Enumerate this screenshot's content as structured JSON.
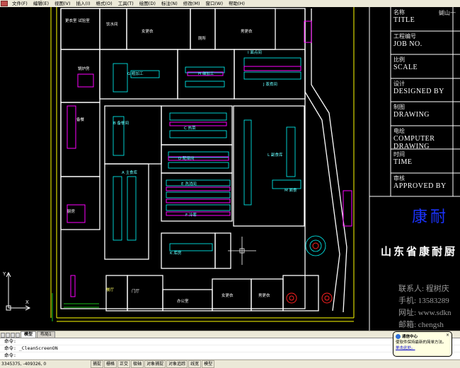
{
  "menu": [
    "文件(F)",
    "编辑(E)",
    "视图(V)",
    "插入(I)",
    "格式(O)",
    "工具(T)",
    "绘图(D)",
    "标注(N)",
    "修改(M)",
    "窗口(W)",
    "帮助(H)"
  ],
  "title_block": {
    "rows": [
      {
        "label": "名称",
        "value": "TITLE"
      },
      {
        "label": "工程编号",
        "value": "JOB NO."
      },
      {
        "label": "比例",
        "value": "SCALE"
      },
      {
        "label": "设计",
        "value": "DESIGNED BY"
      },
      {
        "label": "制图",
        "value": "DRAWING"
      },
      {
        "label": "电绘",
        "value": "COMPUTER DRAWING"
      },
      {
        "label": "时间",
        "value": "TIME"
      },
      {
        "label": "审核",
        "value": "APPROVED BY"
      }
    ],
    "top_note": "蝴山一",
    "logo_text": "康耐",
    "company": "山东省康耐厨",
    "contacts": [
      "联系人: 程树庆",
      "手机: 13583289",
      "网址: www.sdkn",
      "邮箱: chengsh"
    ]
  },
  "room_labels": [
    "更衣室 试验室",
    "饮水间",
    "女更衣",
    "男更衣",
    "厕所",
    "锅炉房",
    "G 粗加工",
    "H 细加工",
    "I 面点间",
    "J 蒸煮间",
    "备餐",
    "B 备餐间",
    "C 热菜",
    "D 配菜间",
    "E 洗消间",
    "L 副食库",
    "F 冷荤",
    "A 主食库",
    "M 面食",
    "K 库房",
    "厨房",
    "门厅",
    "办公室",
    "女更衣",
    "男更衣",
    "餐厅"
  ],
  "ucs": {
    "x_label": "X",
    "y_label": "Y"
  },
  "layout_tabs": {
    "labels": [
      "模型",
      "布局1"
    ],
    "active": "模型"
  },
  "command": {
    "lines": [
      "命令:",
      "命令:  _CleanScreenON",
      "命令:"
    ]
  },
  "status": {
    "coords": "3345375, -409326, 0",
    "buttons": [
      "捕捉",
      "栅格",
      "正交",
      "极轴",
      "对象捕捉",
      "对象追踪",
      "线宽",
      "模型"
    ]
  },
  "balloon": {
    "title": "通信中心",
    "body": "使软件保持最新的简单方法。",
    "link": "单击此处。",
    "close": "×"
  },
  "colors": {
    "background": "#000000",
    "lines": "#ffff00",
    "walls": "#ffffff",
    "equipment": "#00ffff",
    "magenta": "#ff00ff",
    "logo": "#1b33ff"
  }
}
